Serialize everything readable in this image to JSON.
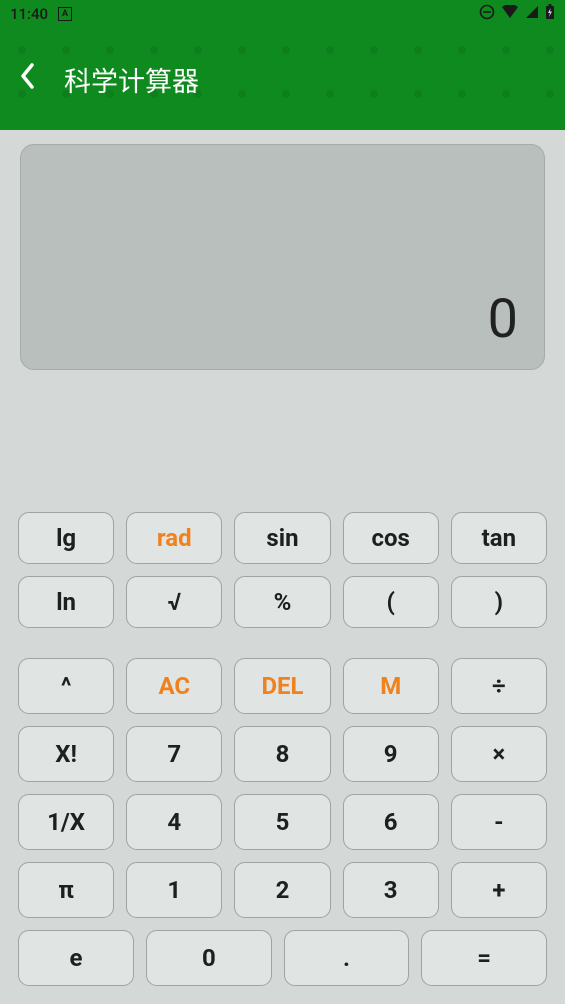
{
  "status": {
    "time": "11:40",
    "icon_a": "A"
  },
  "header": {
    "title": "科学计算器"
  },
  "display": {
    "value": "0"
  },
  "keys": {
    "sci1": {
      "lg": "lg",
      "rad": "rad",
      "sin": "sin",
      "cos": "cos",
      "tan": "tan"
    },
    "sci2": {
      "ln": "ln",
      "sqrt": "√",
      "pct": "%",
      "lp": "(",
      "rp": ")"
    },
    "r1": {
      "pow": "^",
      "ac": "AC",
      "del": "DEL",
      "m": "M",
      "div": "÷"
    },
    "r2": {
      "fact": "X!",
      "n7": "7",
      "n8": "8",
      "n9": "9",
      "mul": "×"
    },
    "r3": {
      "recip": "1/X",
      "n4": "4",
      "n5": "5",
      "n6": "6",
      "sub": "-"
    },
    "r4": {
      "pi": "π",
      "n1": "1",
      "n2": "2",
      "n3": "3",
      "add": "+"
    },
    "r5": {
      "e": "e",
      "n0": "0",
      "dot": ".",
      "eq": "="
    }
  }
}
